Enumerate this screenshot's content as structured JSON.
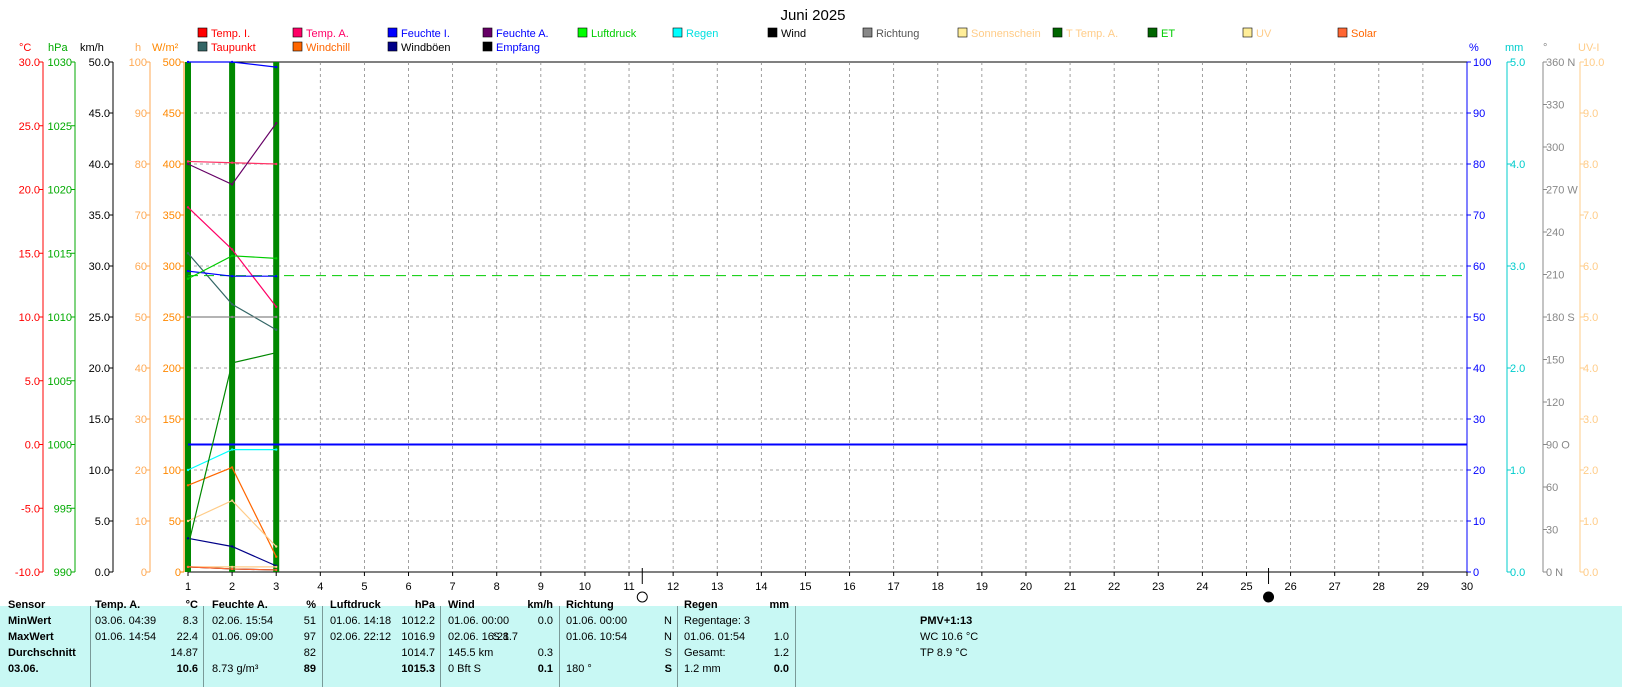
{
  "title": "Juni 2025",
  "axis_units": {
    "temp": "°C",
    "pressure": "hPa",
    "wind": "km/h",
    "sunshine": "h",
    "solar": "W/m²",
    "humidity": "%",
    "rain": "mm",
    "direction": "°",
    "uv": "UV-I"
  },
  "legend": [
    {
      "label": "Temp. I.",
      "color": "#ff0000"
    },
    {
      "label": "Taupunkt",
      "color": "#ff0000"
    },
    {
      "label": "Temp. A.",
      "color": "#ff0066"
    },
    {
      "label": "Windchill",
      "color": "#ff6600"
    },
    {
      "label": "Feuchte I.",
      "color": "#0000ff"
    },
    {
      "label": "Windböen",
      "color": "#000000"
    },
    {
      "label": "Feuchte A.",
      "color": "#0000ff"
    },
    {
      "label": "Empfang",
      "color": "#0000ff"
    },
    {
      "label": "Luftdruck",
      "color": "#00cc00"
    },
    {
      "label": "Regen",
      "color": "#00e0e0"
    },
    {
      "label": "Wind",
      "color": "#000000"
    },
    {
      "label": "Richtung",
      "color": "#555555"
    },
    {
      "label": "Sonnenschein",
      "color": "#ffcc88"
    },
    {
      "label": "T Temp. A.",
      "color": "#ffcc88"
    },
    {
      "label": "ET",
      "color": "#00cc00"
    },
    {
      "label": "UV",
      "color": "#ffcc88"
    },
    {
      "label": "Solar",
      "color": "#ff6600"
    }
  ],
  "legend_swatches": [
    "#ff0000",
    "#336666",
    "#ff0066",
    "#ff6600",
    "#0000ff",
    "#000088",
    "#660066",
    "#000000",
    "#00ff00",
    "#00ffff",
    "#000000",
    "#888888",
    "#ffee99",
    "#006600",
    "#006600",
    "#ffee99",
    "#ff6633"
  ],
  "colors": {
    "temp_axis": "#ff0000",
    "pressure_axis": "#00aa00",
    "wind_axis": "#000000",
    "sun_axis": "#ffaa55",
    "solar_axis": "#ff8800",
    "humidity_axis": "#0000ff",
    "rain_axis": "#00cccc",
    "direction_axis": "#888888",
    "uv_axis": "#ffcc88",
    "day_bar": "#008800",
    "grid": "#888888",
    "stats_bg": "#c8f8f4"
  },
  "chart_data": {
    "type": "line",
    "x": [
      1,
      2,
      3
    ],
    "xlim": [
      1,
      30
    ],
    "x_ticks": [
      1,
      2,
      3,
      4,
      5,
      6,
      7,
      8,
      9,
      10,
      11,
      12,
      13,
      14,
      15,
      16,
      17,
      18,
      19,
      20,
      21,
      22,
      23,
      24,
      25,
      26,
      27,
      28,
      29,
      30
    ],
    "axes": {
      "temp": {
        "range": [
          -10,
          30
        ],
        "ticks": [
          "30.0",
          "25.0",
          "20.0",
          "15.0",
          "10.0",
          "5.0",
          "0.0",
          "-5.0",
          "-10.0"
        ]
      },
      "pressure": {
        "range": [
          990,
          1030
        ],
        "ticks": [
          "1030",
          "1025",
          "1020",
          "1015",
          "1010",
          "1005",
          "1000",
          "995",
          "990"
        ]
      },
      "wind": {
        "range": [
          0,
          50
        ],
        "ticks": [
          "50.0",
          "45.0",
          "40.0",
          "35.0",
          "30.0",
          "25.0",
          "20.0",
          "15.0",
          "10.0",
          "5.0",
          "0.0"
        ]
      },
      "sunshine": {
        "range": [
          0,
          100
        ],
        "ticks": [
          "100",
          "90",
          "80",
          "70",
          "60",
          "50",
          "40",
          "30",
          "20",
          "10",
          "0"
        ]
      },
      "solar": {
        "range": [
          0,
          500
        ],
        "ticks": [
          "500",
          "450",
          "400",
          "350",
          "300",
          "250",
          "200",
          "150",
          "100",
          "50",
          "0"
        ]
      },
      "humidity": {
        "range": [
          0,
          100
        ],
        "ticks": [
          "100",
          "90",
          "80",
          "70",
          "60",
          "50",
          "40",
          "30",
          "20",
          "10",
          "0"
        ]
      },
      "rain": {
        "range": [
          0,
          5
        ],
        "ticks": [
          "5.0",
          "4.0",
          "3.0",
          "2.0",
          "1.0",
          "0.0"
        ]
      },
      "direction": {
        "range": [
          0,
          360
        ],
        "ticks": [
          "360 N",
          "330",
          "300",
          "270 W",
          "240",
          "210",
          "180 S",
          "150",
          "120",
          "90  O",
          "60",
          "30",
          "0   N"
        ]
      },
      "uv": {
        "range": [
          0,
          10
        ],
        "ticks": [
          "10.0",
          "9.0",
          "8.0",
          "7.0",
          "6.0",
          "5.0",
          "4.0",
          "3.0",
          "2.0",
          "1.0",
          "0.0"
        ]
      }
    },
    "series": [
      {
        "name": "Temp. I.",
        "axis": "temp",
        "color": "#ff3366",
        "values": [
          22.2,
          22.1,
          22.0
        ]
      },
      {
        "name": "Temp. A.",
        "axis": "temp",
        "color": "#ff0066",
        "values": [
          18.6,
          15.3,
          10.8
        ]
      },
      {
        "name": "Taupunkt",
        "axis": "temp",
        "color": "#336666",
        "values": [
          15.0,
          11.0,
          9.0
        ]
      },
      {
        "name": "Windchill",
        "axis": "temp",
        "color": "#ff6600",
        "values": [
          -3.2,
          -1.8,
          -8.8
        ]
      },
      {
        "name": "Feuchte I.",
        "axis": "humidity",
        "color": "#0000ff",
        "values": [
          59,
          58,
          58
        ]
      },
      {
        "name": "Feuchte A.",
        "axis": "humidity",
        "color": "#660066",
        "values": [
          80,
          76,
          88
        ]
      },
      {
        "name": "Luftdruck",
        "axis": "pressure",
        "color": "#00cc00",
        "values": [
          1013.0,
          1014.8,
          1014.6
        ]
      },
      {
        "name": "Regen",
        "axis": "rain",
        "color": "#00ffff",
        "values": [
          1.0,
          1.2,
          1.2
        ]
      },
      {
        "name": "Wind",
        "axis": "wind",
        "color": "#000000",
        "values": [
          0.5,
          0.3,
          0.2
        ]
      },
      {
        "name": "Windböen",
        "axis": "wind",
        "color": "#000088",
        "values": [
          3.3,
          2.5,
          0.6
        ]
      },
      {
        "name": "Richtung",
        "axis": "direction",
        "color": "#888888",
        "values": [
          180,
          180,
          180
        ]
      },
      {
        "name": "Sonnenschein",
        "axis": "sunshine",
        "color": "#ffcc88",
        "values": [
          10,
          14,
          5
        ]
      },
      {
        "name": "ET",
        "axis": "pressure",
        "color": "#008800",
        "values": [
          992,
          1006.4,
          1007.2
        ]
      },
      {
        "name": "UV",
        "axis": "uv",
        "color": "#ffcc88",
        "values": [
          0.1,
          0.1,
          0.1
        ]
      },
      {
        "name": "Solar",
        "axis": "solar",
        "color": "#ff6633",
        "values": [
          5,
          3,
          2
        ]
      },
      {
        "name": "Empfang",
        "axis": "humidity",
        "color": "#0000ff",
        "values": [
          100,
          100,
          99
        ]
      }
    ],
    "reference_lines": [
      {
        "axis": "humidity",
        "value": 25,
        "color": "#0000ff",
        "style": "solid"
      },
      {
        "axis": "pressure",
        "value": 1013.25,
        "color": "#00cc00",
        "style": "dashed"
      }
    ],
    "moon_phases": [
      {
        "x": 11.3,
        "phase": "full"
      },
      {
        "x": 25.5,
        "phase": "new"
      }
    ],
    "grid": true
  },
  "stats": {
    "sensor_header": "Sensor",
    "row_labels": [
      "MinWert",
      "MaxWert",
      "Durchschnitt",
      "03.06."
    ],
    "temp": {
      "header": "Temp. A.",
      "unit": "°C",
      "rows": [
        [
          "03.06.  04:39",
          "8.3"
        ],
        [
          "01.06.  14:54",
          "22.4"
        ],
        [
          "",
          "14.87"
        ],
        [
          "",
          "10.6"
        ]
      ]
    },
    "humidity": {
      "header": "Feuchte A.",
      "unit": "%",
      "rows": [
        [
          "02.06.  15:54",
          "51"
        ],
        [
          "01.06.  09:00",
          "97"
        ],
        [
          "",
          "82"
        ],
        [
          "8.73 g/m³",
          "89"
        ]
      ]
    },
    "pressure": {
      "header": "Luftdruck",
      "unit": "hPa",
      "rows": [
        [
          "01.06.  14:18",
          "1012.2"
        ],
        [
          "02.06.  22:12",
          "1016.9"
        ],
        [
          "",
          "1014.7"
        ],
        [
          "",
          "1015.3"
        ]
      ]
    },
    "wind": {
      "header": "Wind",
      "unit": "km/h",
      "rows": [
        [
          "01.06.  00:00",
          "",
          "0.0"
        ],
        [
          "02.06.  16:21",
          "S 8.7",
          ""
        ],
        [
          "145.5 km",
          "",
          "0.3"
        ],
        [
          "0 Bft S",
          "",
          "0.1"
        ]
      ]
    },
    "direction": {
      "header": "Richtung",
      "rows": [
        [
          "01.06.  00:00",
          "N"
        ],
        [
          "01.06.  10:54",
          "N"
        ],
        [
          "",
          "S"
        ],
        [
          "180 °",
          "S"
        ]
      ]
    },
    "rain": {
      "header": "Regen",
      "unit": "mm",
      "rows": [
        [
          "Regentage: 3",
          ""
        ],
        [
          "01.06.  01:54",
          "1.0"
        ],
        [
          "Gesamt:",
          "1.2"
        ],
        [
          "1.2 mm",
          "0.0"
        ]
      ]
    },
    "extra": [
      "PMV+1:13",
      "WC 10.6 °C",
      "TP 8.9 °C"
    ]
  }
}
